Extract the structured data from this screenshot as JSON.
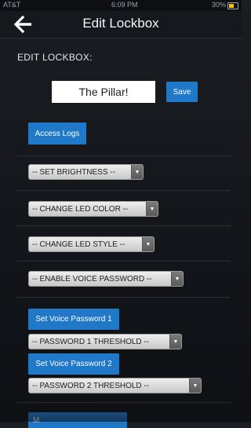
{
  "status_bar": {
    "carrier": "AT&T",
    "time": "6:09 PM",
    "battery": "30%"
  },
  "navbar": {
    "title": "Edit Lockbox",
    "back_icon": "arrow-left-icon"
  },
  "section_title": "EDIT LOCKBOX:",
  "lockbox_name": {
    "value": "The Pillar!"
  },
  "buttons": {
    "save": "Save",
    "access_logs": "Access Logs",
    "set_voice_password_1": "Set Voice Password 1",
    "set_voice_password_2": "Set Voice Password 2",
    "partial_bottom": "M"
  },
  "selects": {
    "brightness": "-- SET BRIGHTNESS --",
    "led_color": "-- CHANGE LED COLOR --",
    "led_style": "-- CHANGE LED STYLE --",
    "voice_password": "-- ENABLE VOICE PASSWORD --",
    "password1_threshold": "-- PASSWORD 1 THRESHOLD --",
    "password2_threshold": "-- PASSWORD 2 THRESHOLD --"
  },
  "colors": {
    "accent_blue": "#1f78c8",
    "background": "#111418"
  }
}
